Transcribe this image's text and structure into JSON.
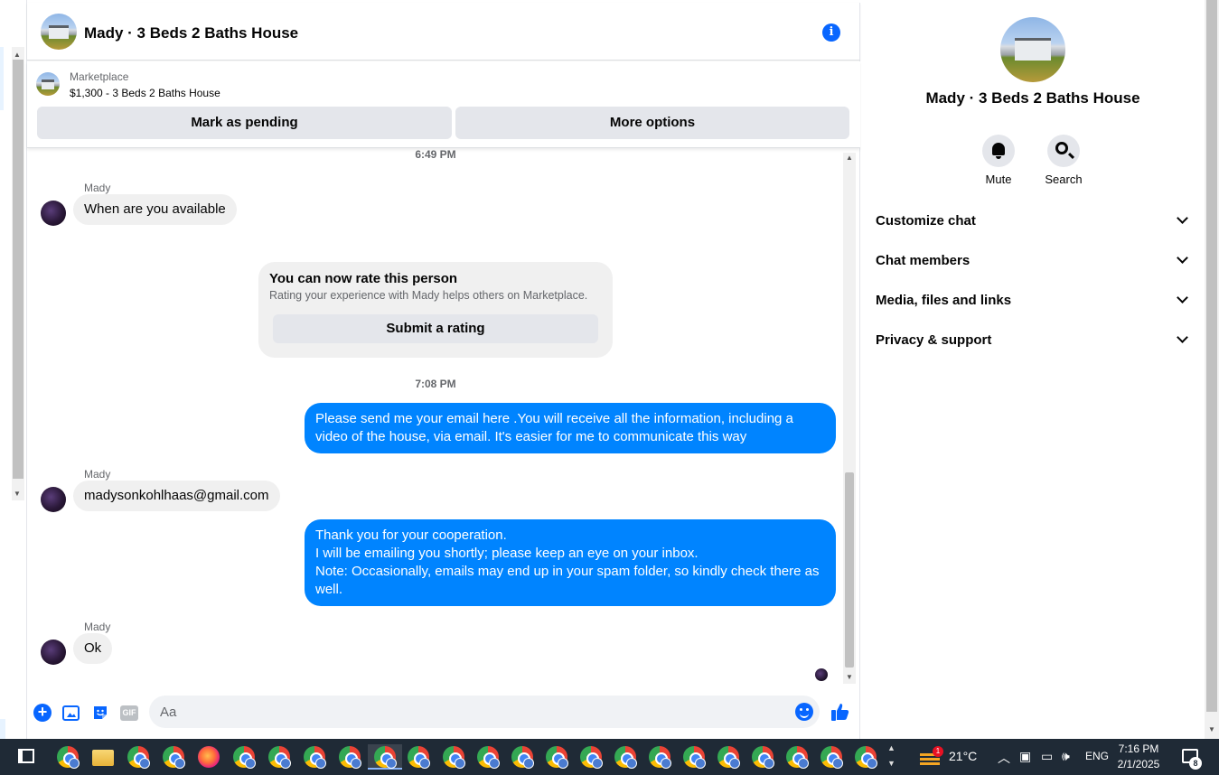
{
  "chat": {
    "title": "Mady · 3 Beds 2 Baths House",
    "marketplace_label": "Marketplace",
    "listing": "$1,300 - 3 Beds 2 Baths House",
    "mark_pending_label": "Mark as pending",
    "more_options_label": "More options"
  },
  "messages": {
    "ts_top": "6:49 PM",
    "ts_mid": "7:08 PM",
    "sender_name": "Mady",
    "msg1": "When are you available",
    "rating": {
      "title": "You can now rate this person",
      "subtitle": "Rating your experience with Mady helps others on Marketplace.",
      "button": "Submit a rating"
    },
    "out1": "Please send me your email here .You will receive all the information, including a video of the house, via email. It's easier for me to communicate this way",
    "msg2": "madysonkohlhaas@gmail.com",
    "out2_lines": [
      "Thank you for your cooperation.",
      "I will be emailing you shortly; please keep an eye on your inbox.",
      "Note: Occasionally, emails may end up in your spam folder, so kindly check there as well."
    ],
    "msg3": "Ok"
  },
  "composer": {
    "placeholder": "Aa",
    "gif_label": "GIF"
  },
  "details": {
    "title": "Mady · 3 Beds 2 Baths House",
    "mute_label": "Mute",
    "search_label": "Search",
    "sections": [
      "Customize chat",
      "Chat members",
      "Media, files and links",
      "Privacy & support"
    ]
  },
  "taskbar": {
    "weather_badge": "1",
    "temperature": "21°C",
    "language": "ENG",
    "time": "7:16 PM",
    "date": "2/1/2025",
    "notification_count": "8"
  },
  "colors": {
    "accent": "#0866ff",
    "outgoing_bubble": "#0084ff",
    "incoming_bubble": "#f0f0f0",
    "taskbar": "#1f2a36"
  }
}
